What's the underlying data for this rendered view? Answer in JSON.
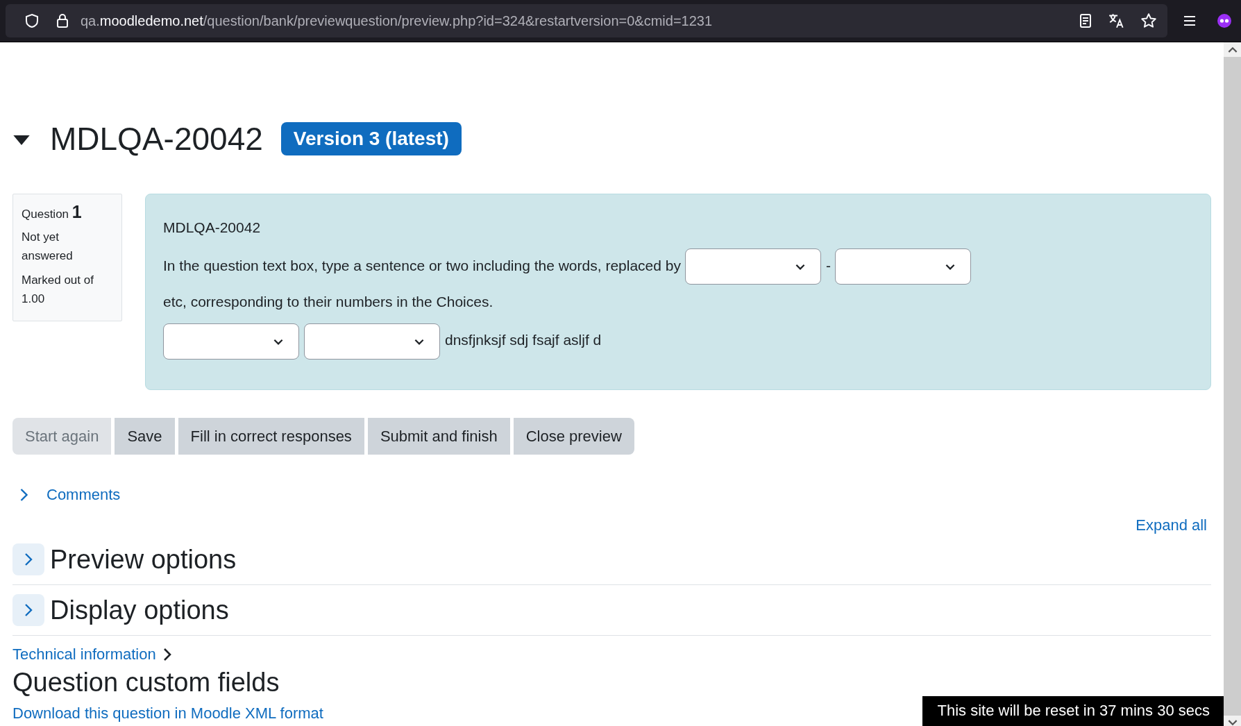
{
  "browser": {
    "url": {
      "prefix": "qa.",
      "domain": "moodledemo.net",
      "path": "/question/bank/previewquestion/preview.php?id=324&restartversion=0&cmid=1231"
    }
  },
  "heading": {
    "title": "MDLQA-20042",
    "expanded": true,
    "badge": "Version 3 (latest)"
  },
  "info": {
    "label": "Question",
    "number": "1",
    "state": "Not yet answered",
    "marks": "Marked out of 1.00"
  },
  "question": {
    "name": "MDLQA-20042",
    "paragraphs": [
      [
        {
          "kind": "text",
          "text": "In the question text box, type a sentence or two including the words, replaced by"
        },
        {
          "kind": "select"
        },
        {
          "kind": "text",
          "text": "-"
        },
        {
          "kind": "select"
        },
        {
          "kind": "text",
          "text": "etc, corresponding to"
        },
        {
          "kind": "text",
          "text": "their numbers in the Choices."
        }
      ],
      [
        {
          "kind": "select"
        },
        {
          "kind": "select"
        },
        {
          "kind": "text",
          "text": "dnsfjnksjf sdj fsajf asljf d"
        }
      ]
    ]
  },
  "buttons": [
    {
      "label": "Start again",
      "disabled": true
    },
    {
      "label": "Save",
      "disabled": false
    },
    {
      "label": "Fill in correct responses",
      "disabled": false
    },
    {
      "label": "Submit and finish",
      "disabled": false
    },
    {
      "label": "Close preview",
      "disabled": false
    }
  ],
  "comments": {
    "label": "Comments",
    "expanded": false
  },
  "expand_all": "Expand all",
  "sections": [
    {
      "title": "Preview options",
      "expanded": false
    },
    {
      "title": "Display options",
      "expanded": false
    }
  ],
  "technical_info": "Technical information",
  "custom_fields_heading": "Question custom fields",
  "download_link": "Download this question in Moodle XML format",
  "reset_notice": "This site will be reset in 37 mins 30 secs"
}
